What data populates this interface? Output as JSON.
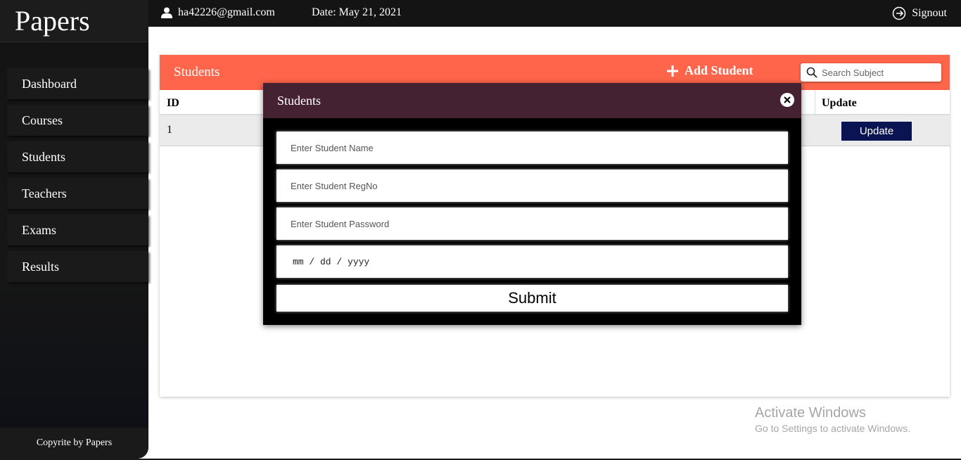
{
  "sidebar": {
    "brand": "Papers",
    "items": [
      {
        "label": "Dashboard"
      },
      {
        "label": "Courses"
      },
      {
        "label": "Students"
      },
      {
        "label": "Teachers"
      },
      {
        "label": "Exams"
      },
      {
        "label": "Results"
      }
    ],
    "footer": "Copyrite by Papers"
  },
  "topbar": {
    "user_email": "ha42226@gmail.com",
    "date": "Date: May 21, 2021",
    "signout_label": "Signout"
  },
  "card": {
    "title": "Students",
    "add_label": "Add Student",
    "search_placeholder": "Search Subject",
    "columns": {
      "id": "ID",
      "update": "Update"
    },
    "rows": [
      {
        "id": "1",
        "update_label": "Update"
      }
    ]
  },
  "modal": {
    "title": "Students",
    "name_placeholder": "Enter Student Name",
    "regno_placeholder": "Enter Student RegNo",
    "password_placeholder": "Enter Student Password",
    "date_placeholder": "mm / dd / yyyy",
    "submit_label": "Submit"
  },
  "watermark": {
    "line1": "Activate Windows",
    "line2": "Go to Settings to activate Windows."
  },
  "colors": {
    "accent": "#fe654a",
    "modal_header": "#452232",
    "update_button": "#0b1453"
  }
}
